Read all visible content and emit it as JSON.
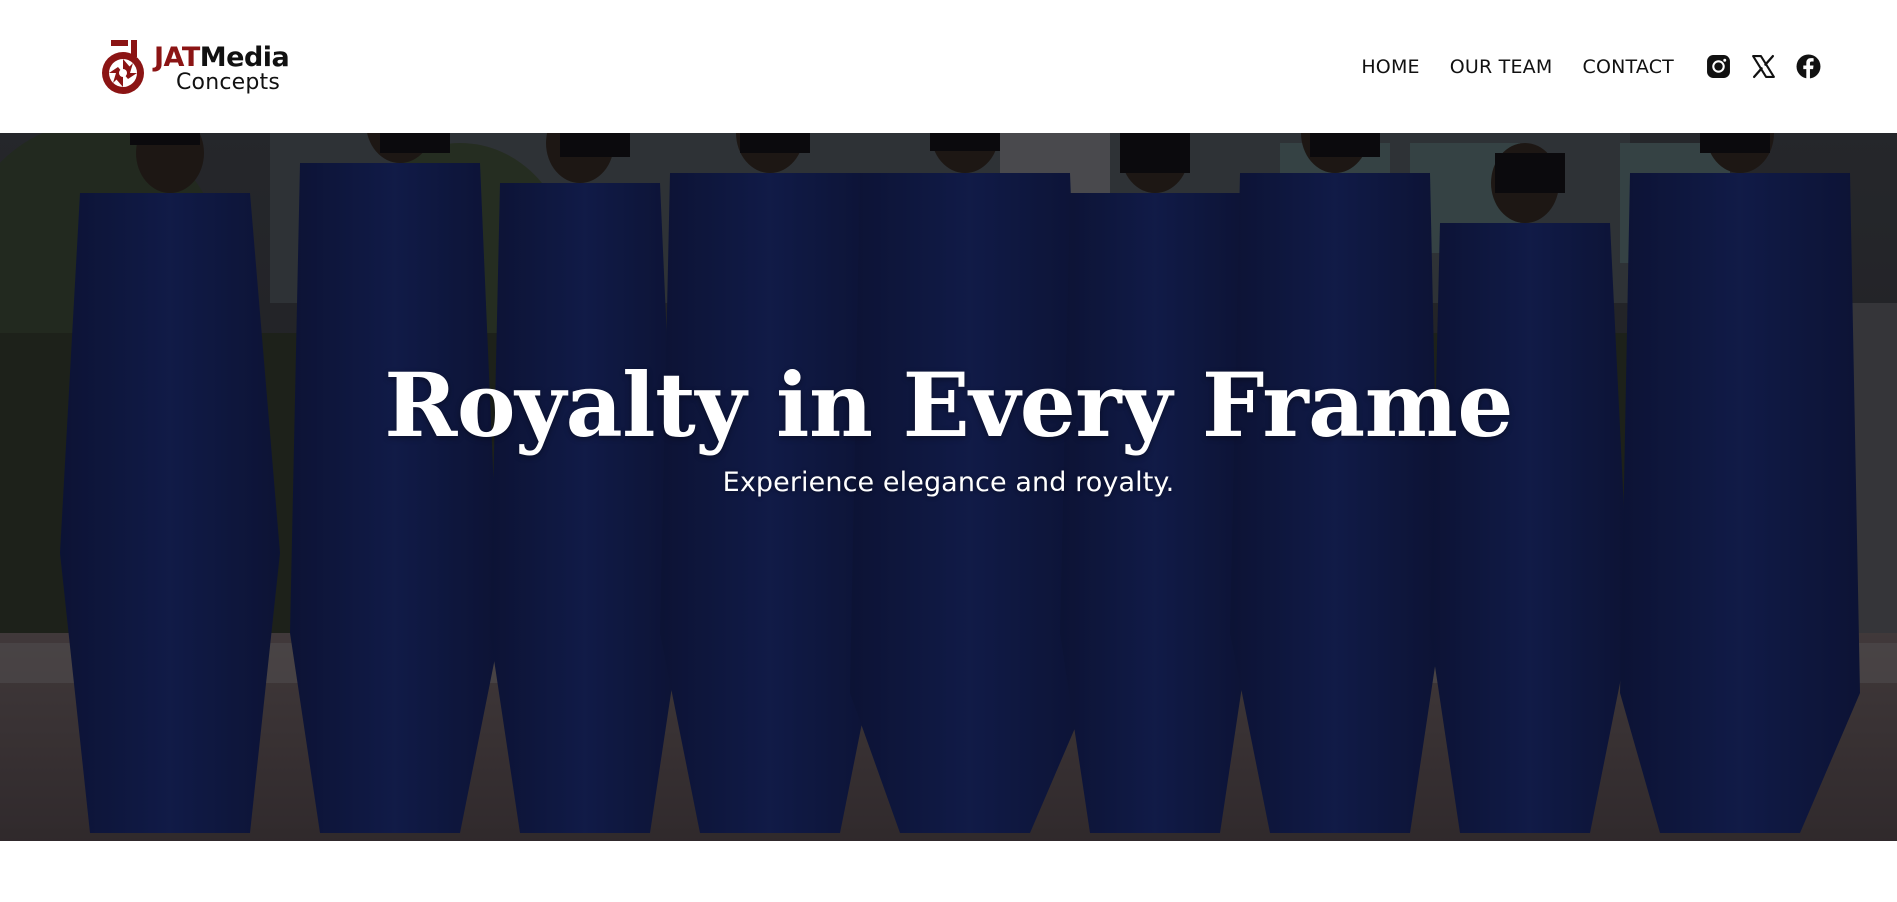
{
  "header": {
    "logo": {
      "brand_part1": "JAT",
      "brand_part2": "Media",
      "brand_line2": "Concepts",
      "brand_color": "#8b1414",
      "icon": "camera-aperture-logo-icon"
    },
    "nav": [
      {
        "label": "HOME"
      },
      {
        "label": "OUR TEAM"
      },
      {
        "label": "CONTACT"
      }
    ],
    "social": [
      {
        "icon": "instagram-icon"
      },
      {
        "icon": "x-twitter-icon"
      },
      {
        "icon": "facebook-icon"
      }
    ]
  },
  "hero": {
    "title": "Royalty in Every Frame",
    "subtitle": "Experience elegance and royalty.",
    "background": "photo of nine men in navy blue traditional attire and caps standing in a row",
    "overlay_color": "#0e0c12"
  }
}
